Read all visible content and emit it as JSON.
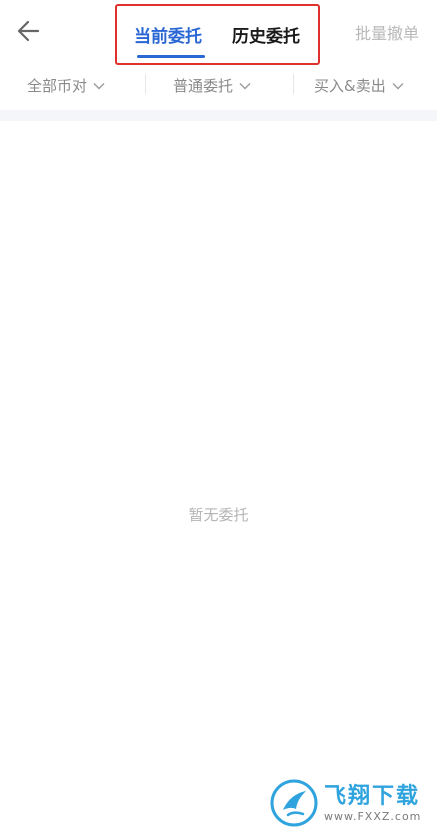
{
  "header": {
    "back_icon": "arrow-left-icon",
    "tabs": [
      {
        "label": "当前委托",
        "active": true
      },
      {
        "label": "历史委托",
        "active": false
      }
    ],
    "batch_cancel_label": "批量撤单",
    "active_color": "#2a67d4",
    "highlight_color": "#e0302b"
  },
  "filters": [
    {
      "label": "全部币对",
      "icon": "chevron-down-icon"
    },
    {
      "label": "普通委托",
      "icon": "chevron-down-icon"
    },
    {
      "label": "买入&卖出",
      "icon": "chevron-down-icon"
    }
  ],
  "main": {
    "empty_text": "暂无委托"
  },
  "watermark": {
    "title": "飞翔下载",
    "url": "www.FXXZ.com"
  }
}
